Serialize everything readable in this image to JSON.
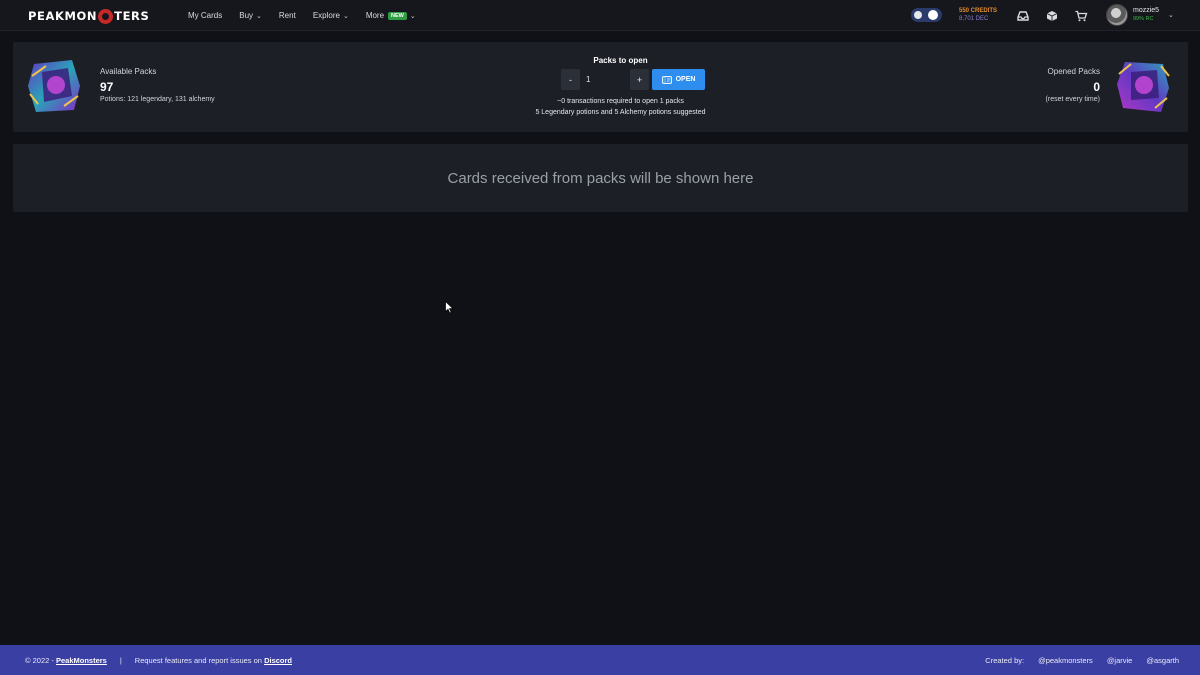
{
  "nav": {
    "logo_left": "PEAKMON",
    "logo_right": "TERS",
    "links": [
      {
        "label": "My Cards"
      },
      {
        "label": "Buy"
      },
      {
        "label": "Rent"
      },
      {
        "label": "Explore"
      },
      {
        "label": "More"
      }
    ],
    "new_badge": "NEW",
    "credits": "550 CREDITS",
    "dec": "8,701 DEC",
    "username": "mozzie5",
    "rc": "99% RC"
  },
  "packs": {
    "available_label": "Available Packs",
    "available_count": "97",
    "potions": "Potions: 121 legendary, 131 alchemy",
    "to_open_label": "Packs to open",
    "minus": "-",
    "plus": "+",
    "quantity": "1",
    "open_label": "OPEN",
    "transactions_info": "~0 transactions required to open 1 packs",
    "suggestion_info": "5 Legendary potions and 5 Alchemy potions suggested",
    "opened_label": "Opened Packs",
    "opened_count": "0",
    "reset_note": "(reset every time)"
  },
  "cards": {
    "placeholder": "Cards received from packs will be shown here"
  },
  "footer": {
    "copyright": "© 2022 -",
    "brand": "PeakMonsters",
    "separator": "|",
    "request_text": "Request features and report issues on",
    "discord": "Discord",
    "created_by": "Created by:",
    "creators": [
      "@peakmonsters",
      "@jarvie",
      "@asgarth"
    ]
  },
  "colors": {
    "background": "#0f1116",
    "panel": "#1c1f25",
    "accent_blue": "#2d8ef0",
    "footer": "#3a3fa3",
    "new_badge": "#2e9e44",
    "credits": "#e58b2c"
  }
}
